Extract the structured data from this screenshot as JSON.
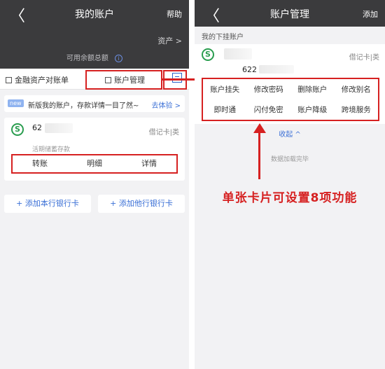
{
  "left": {
    "back_glyph": "〈",
    "title": "我的账户",
    "help": "帮助",
    "assets_link": "资产 >",
    "balance_label": "可用余额总额",
    "info_glyph": "i",
    "tab_statement": "金融资产对账单",
    "tab_manage": "账户管理",
    "notice": {
      "badge": "new",
      "text": "新版我的账户，存款详情一目了然~",
      "cta": "去体验 >"
    },
    "card": {
      "logo": "S",
      "number": "62",
      "type": "借记卡|类",
      "subtype": "活期储蓄存款"
    },
    "buttons": [
      "转账",
      "明细",
      "详情"
    ],
    "add_own": "+ 添加本行银行卡",
    "add_other": "+ 添加他行银行卡"
  },
  "right": {
    "back_glyph": "〈",
    "title": "账户管理",
    "add": "添加",
    "section_label": "我的下挂账户",
    "card": {
      "logo": "S",
      "type": "借记卡|类",
      "number": "622"
    },
    "functions": [
      "账户挂失",
      "修改密码",
      "删除账户",
      "修改别名",
      "即时通",
      "闪付免密",
      "账户降级",
      "跨境服务"
    ],
    "collapse": "收起 ^",
    "loaded": "数据加载完毕"
  },
  "annotation": "单张卡片可设置8项功能",
  "colors": {
    "dark_header": "#3b3b3d",
    "highlight": "#d62121",
    "link": "#3a6fd6",
    "bank_green": "#2a9d4f"
  }
}
